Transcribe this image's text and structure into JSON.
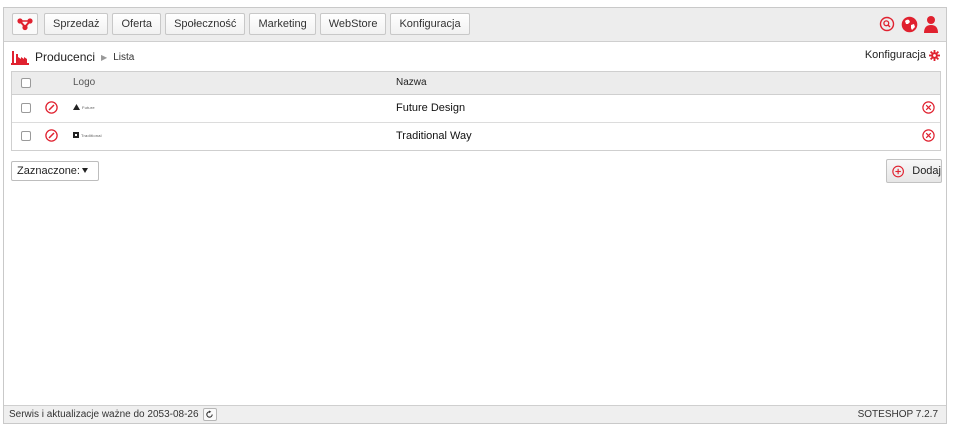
{
  "nav": {
    "items": [
      "Sprzedaż",
      "Oferta",
      "Społeczność",
      "Marketing",
      "WebStore",
      "Konfiguracja"
    ]
  },
  "breadcrumb": {
    "title": "Producenci",
    "current": "Lista"
  },
  "config_link": "Konfiguracja",
  "table": {
    "columns": {
      "logo": "Logo",
      "name": "Nazwa"
    },
    "rows": [
      {
        "name": "Future Design",
        "logo_text": "Future"
      },
      {
        "name": "Traditional Way",
        "logo_text": "Traditional"
      }
    ]
  },
  "bulk_select": {
    "label": "Zaznaczone:"
  },
  "add_button": {
    "label": "Dodaj"
  },
  "footer": {
    "service_text": "Serwis i aktualizacje ważne do 2053-08-26",
    "version": "SOTESHOP 7.2.7"
  },
  "colors": {
    "accent": "#e0212f"
  }
}
